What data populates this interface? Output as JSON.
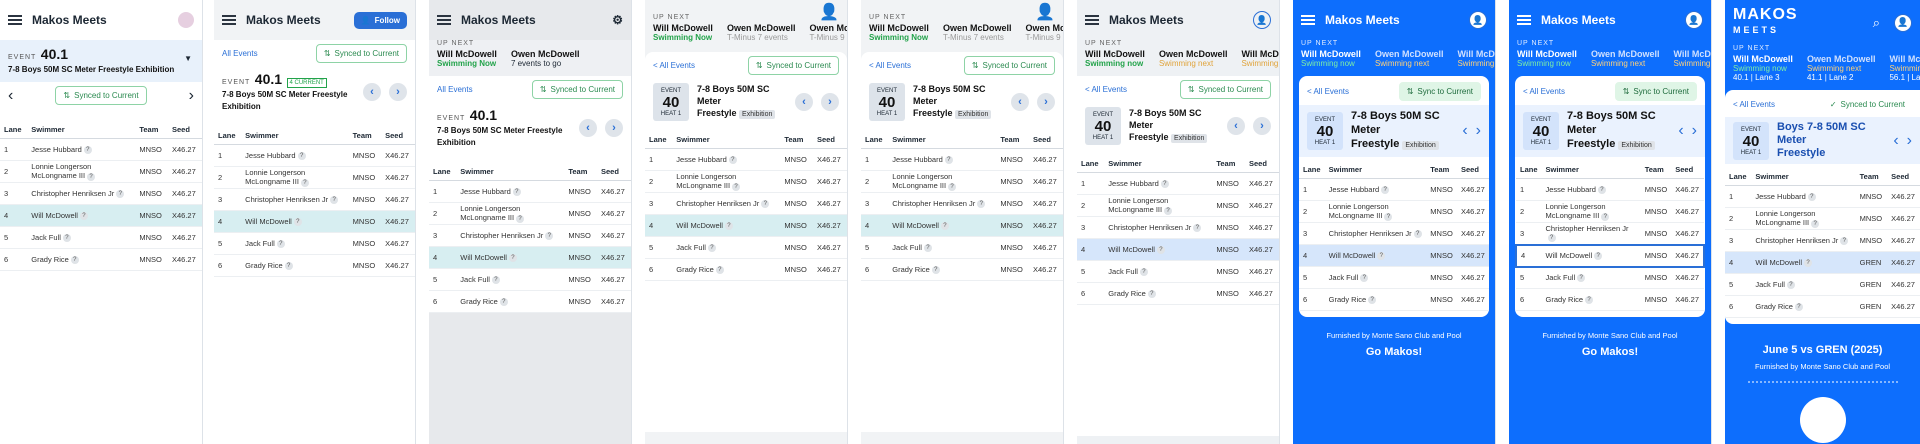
{
  "app_title": "Makos Meets",
  "follow": "Follow",
  "all_events": "All Events",
  "all_events_back": "< All Events",
  "synced": "Synced to Current",
  "sync_to": "Sync to Current",
  "current_badge": "4 CURRENT",
  "event_label": "EVENT",
  "event_num": "40.1",
  "event_short": "40",
  "heat": "HEAT 1",
  "event_name": "7-8 Boys 50M SC Meter Freestyle Exhibition",
  "event_name_a": "7-8 Boys 50M SC Meter",
  "event_name_b": "Freestyle",
  "event_name_c": "Boys 7-8 50M SC Meter",
  "exhibition": "Exhibition",
  "up_next": "UP NEXT",
  "swimmer_now": "Will McDowell",
  "swimming_now": "Swimming Now",
  "swimming_now_l": "Swimming now",
  "swimmer_next": "Owen McDowell",
  "events_to_go": "7 events to go",
  "t_minus": "T-Minus 7 events",
  "t_minus2": "T-Minus 9",
  "swimming_next": "Swimming next",
  "swimmer_third": "Will McDo",
  "lane_info_1": "40.1 | Lane 3",
  "lane_info_2": "41.1 | Lane 2",
  "lane_info_3": "56.1 | La",
  "columns": [
    "Lane",
    "Swimmer",
    "Team",
    "Seed"
  ],
  "rows": [
    {
      "lane": "1",
      "name": "Jesse Hubbard",
      "name2": "",
      "team": "MNSO",
      "seed": "X46.27"
    },
    {
      "lane": "2",
      "name": "Lonnie Longerson",
      "name2": "McLongname III",
      "team": "MNSO",
      "seed": "X46.27"
    },
    {
      "lane": "3",
      "name": "Christopher Henriksen Jr",
      "name2": "",
      "team": "MNSO",
      "seed": "X46.27"
    },
    {
      "lane": "4",
      "name": "Will McDowell",
      "name2": "",
      "team": "MNSO",
      "seed": "X46.27"
    },
    {
      "lane": "5",
      "name": "Jack Full",
      "name2": "",
      "team": "MNSO",
      "seed": "X46.27"
    },
    {
      "lane": "6",
      "name": "Grady Rice",
      "name2": "",
      "team": "MNSO",
      "seed": "X46.27"
    }
  ],
  "furnished": "Furnished by Monte Sano Club and Pool",
  "go_makos": "Go Makos!",
  "meet_title": "June 5 vs GREN (2025)",
  "gren": "GREN",
  "logo_top": "MAKOS",
  "logo_bot": "MEETS",
  "colors": {
    "blue": "#0d6efd",
    "green": "#22a34a",
    "teal_row": "#d7eef1"
  }
}
